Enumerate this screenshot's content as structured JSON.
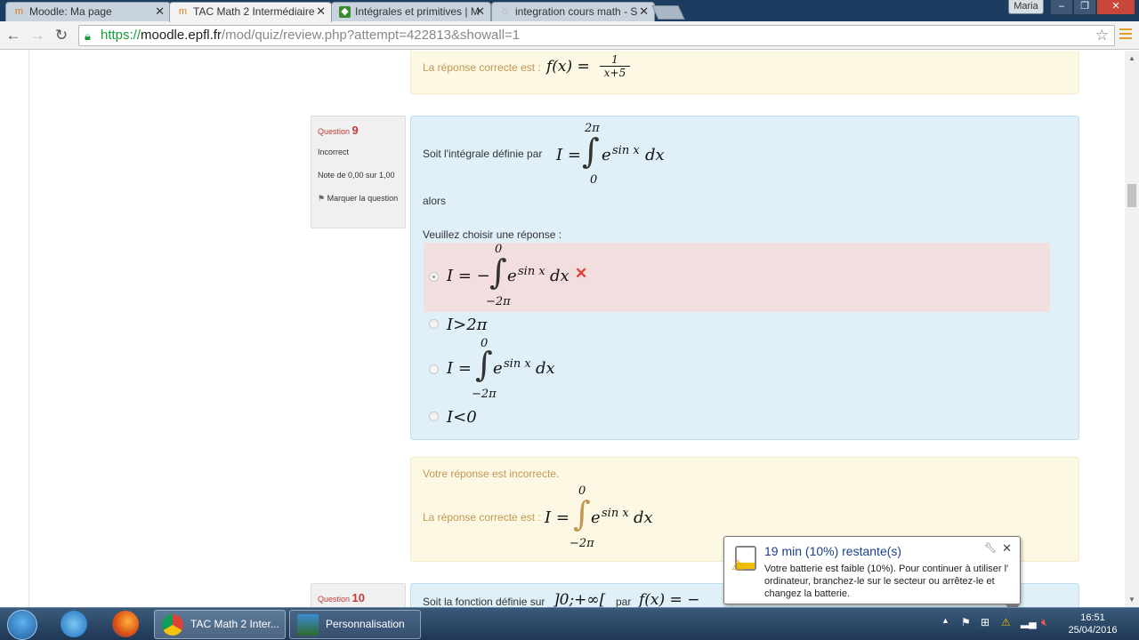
{
  "browser": {
    "tabs": [
      {
        "title": "Moodle: Ma page",
        "icon": "moodle-icon"
      },
      {
        "title": "TAC Math 2 Intermédiaire",
        "icon": "moodle-icon"
      },
      {
        "title": "Intégrales et primitives | M",
        "icon": "site-icon"
      },
      {
        "title": "integration cours math - S",
        "icon": "loading-icon"
      }
    ],
    "user": "Maria",
    "url_scheme": "https://",
    "url_host": "moodle.epfl.fr",
    "url_path": "/mod/quiz/review.php?attempt=422813&showall=1"
  },
  "prev_feedback": {
    "label": "La réponse correcte est :",
    "answer": "f(x) =",
    "numerator": "1",
    "denominator": "x+5"
  },
  "question9": {
    "label": "Question",
    "number": "9",
    "state": "Incorrect",
    "grade": "Note de 0,00 sur 1,00",
    "flag_label": "Marquer la question",
    "stem": "Soit l'intégrale définie par",
    "integral_lhs": "I =",
    "integral_upper": "2π",
    "integral_lower": "0",
    "integrand": "e",
    "integrand_exp": "sin x",
    "dx": "dx",
    "alors": "alors",
    "prompt": "Veuillez choisir une réponse :",
    "options": [
      {
        "lhs": "I = −",
        "upper": "0",
        "lower": "−2π",
        "integrand": "e",
        "exp": "sin x",
        "dx": "dx",
        "selected": true,
        "incorrect": true
      },
      {
        "text": "I>2π",
        "selected": false
      },
      {
        "lhs": "I =",
        "upper": "0",
        "lower": "−2π",
        "integrand": "e",
        "exp": "sin x",
        "dx": "dx",
        "selected": false
      },
      {
        "text": "I<0",
        "selected": false
      }
    ]
  },
  "feedback9": {
    "result": "Votre réponse est incorrecte.",
    "label": "La réponse correcte est :",
    "lhs": "I =",
    "upper": "0",
    "lower": "−2π",
    "integrand": "e",
    "exp": "sin x",
    "dx": "dx"
  },
  "question10": {
    "label": "Question",
    "number": "10",
    "stem": "Soit la fonction définie sur",
    "interval": "]0;+∞[",
    "par": "par",
    "func": "f(x) = −"
  },
  "taskbar": {
    "tasks": [
      "TAC Math 2 Inter...",
      "Personnalisation"
    ],
    "time": "16:51",
    "date": "25/04/2016"
  },
  "battery_balloon": {
    "title": "19 min (10%) restante(s)",
    "body": "Votre batterie est faible (10%). Pour continuer à utiliser l' ordinateur, branchez-le sur le secteur ou arrêtez-le et changez la batterie."
  }
}
